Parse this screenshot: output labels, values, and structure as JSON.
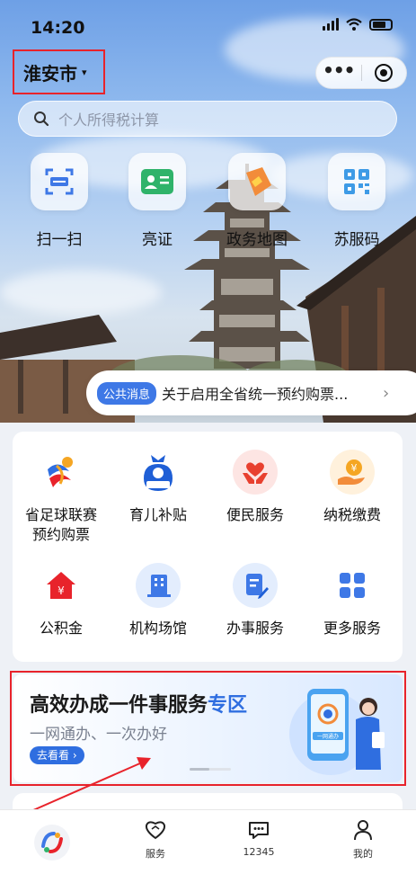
{
  "status": {
    "time": "14:20"
  },
  "header": {
    "city": "淮安市",
    "city_caret": "▾"
  },
  "search": {
    "placeholder": "个人所得税计算"
  },
  "quick_actions": [
    {
      "label": "扫一扫",
      "icon": "scan-icon"
    },
    {
      "label": "亮证",
      "icon": "id-card-icon"
    },
    {
      "label": "政务地图",
      "icon": "map-pin-icon"
    },
    {
      "label": "苏服码",
      "icon": "qr-code-icon"
    }
  ],
  "notice": {
    "tag": "公共消息",
    "text": "关于启用全省统一预约购票...",
    "chevron": "›"
  },
  "services": [
    {
      "label": "省足球联赛\n预约购票",
      "icon": "football-league-icon"
    },
    {
      "label": "育儿补贴",
      "icon": "childcare-subsidy-icon",
      "icon_text": "育儿补贴"
    },
    {
      "label": "便民服务",
      "icon": "heart-hands-icon"
    },
    {
      "label": "纳税缴费",
      "icon": "yen-hand-icon"
    },
    {
      "label": "公积金",
      "icon": "housing-fund-icon"
    },
    {
      "label": "机构场馆",
      "icon": "building-icon"
    },
    {
      "label": "办事服务",
      "icon": "document-edit-icon"
    },
    {
      "label": "更多服务",
      "icon": "grid-icon"
    }
  ],
  "banner": {
    "title_main": "高效办成一件事服务",
    "title_highlight": "专区",
    "subtitle": "一网通办、一次办好",
    "button": "去看看 ›",
    "art_text": "一网通办"
  },
  "tabbar": [
    {
      "label": "",
      "icon": "home-logo-icon"
    },
    {
      "label": "服务",
      "icon": "heart-icon"
    },
    {
      "label": "12345",
      "icon": "chat-icon"
    },
    {
      "label": "我的",
      "icon": "user-icon"
    }
  ],
  "colors": {
    "accent": "#2f6ee0",
    "highlight_border": "#e8232b"
  }
}
